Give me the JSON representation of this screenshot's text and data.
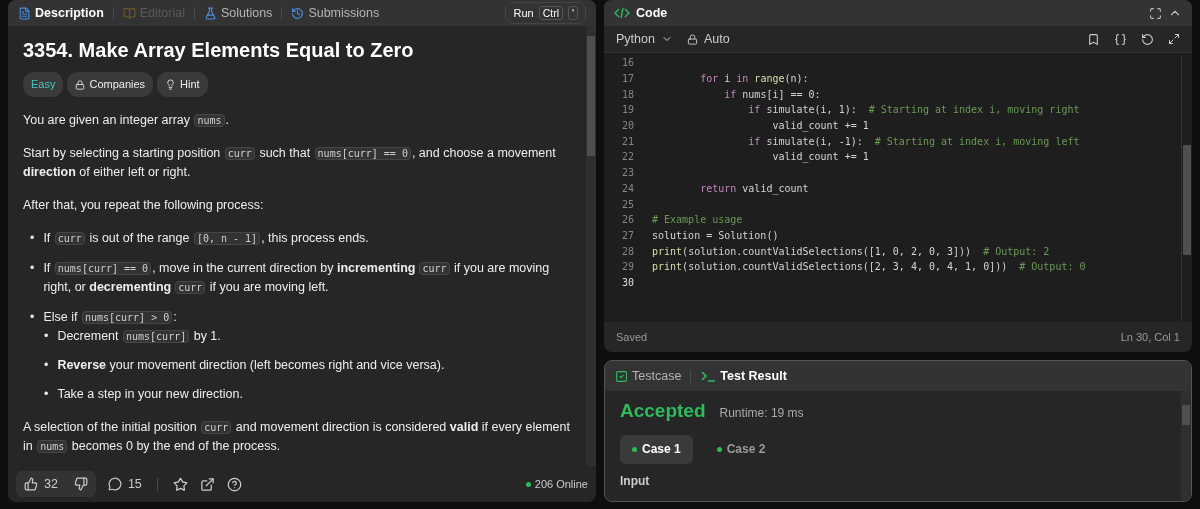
{
  "description_panel": {
    "tabs": [
      {
        "label": "Description",
        "kind": "doc",
        "selected": true,
        "disabled": false
      },
      {
        "label": "Editorial",
        "kind": "book",
        "selected": false,
        "disabled": true
      },
      {
        "label": "Solutions",
        "kind": "flask",
        "selected": false,
        "disabled": false
      },
      {
        "label": "Submissions",
        "kind": "history",
        "selected": false,
        "disabled": false
      }
    ],
    "run_button": {
      "label": "Run",
      "keys": [
        "Ctrl",
        "'"
      ]
    },
    "title": "3354. Make Array Elements Equal to Zero",
    "tags": [
      {
        "label": "Easy",
        "kind": "difficulty"
      },
      {
        "label": "Companies",
        "kind": "lock"
      },
      {
        "label": "Hint",
        "kind": "bulb"
      }
    ],
    "blocks": [
      {
        "kind": "p",
        "parts": [
          {
            "kind": "text",
            "text": "You are given an integer array "
          },
          {
            "kind": "code",
            "text": "nums"
          },
          {
            "kind": "text",
            "text": "."
          }
        ]
      },
      {
        "kind": "p",
        "parts": [
          {
            "kind": "text",
            "text": "Start by selecting a starting position "
          },
          {
            "kind": "code",
            "text": "curr"
          },
          {
            "kind": "text",
            "text": " such that "
          },
          {
            "kind": "code",
            "text": "nums[curr] == 0"
          },
          {
            "kind": "text",
            "text": ", and choose a movement "
          },
          {
            "kind": "bold",
            "text": "direction"
          },
          {
            "kind": "text",
            "text": " of either left or right."
          }
        ]
      },
      {
        "kind": "p",
        "parts": [
          {
            "kind": "text",
            "text": "After that, you repeat the following process:"
          }
        ]
      },
      {
        "kind": "list",
        "items": [
          {
            "marker": "•",
            "parts": [
              {
                "kind": "text",
                "text": "If "
              },
              {
                "kind": "code",
                "text": "curr"
              },
              {
                "kind": "text",
                "text": " is out of the range "
              },
              {
                "kind": "code",
                "text": "[0, n - 1]"
              },
              {
                "kind": "text",
                "text": ", this process ends."
              }
            ]
          },
          {
            "marker": "•",
            "parts": [
              {
                "kind": "text",
                "text": "If "
              },
              {
                "kind": "code",
                "text": "nums[curr] == 0"
              },
              {
                "kind": "text",
                "text": ", move in the current direction by "
              },
              {
                "kind": "bold",
                "text": "incrementing"
              },
              {
                "kind": "code",
                "text": "curr"
              },
              {
                "kind": "text",
                "text": " if you are moving right, or "
              },
              {
                "kind": "bold",
                "text": "decrementing"
              },
              {
                "kind": "code",
                "text": "curr"
              },
              {
                "kind": "text",
                "text": " if you are moving left."
              }
            ]
          },
          {
            "marker": "•",
            "parts": [
              {
                "kind": "text",
                "text": "Else if "
              },
              {
                "kind": "code",
                "text": "nums[curr] > 0"
              },
              {
                "kind": "text",
                "text": ":"
              }
            ],
            "children": [
              {
                "marker": "•",
                "parts": [
                  {
                    "kind": "text",
                    "text": "Decrement "
                  },
                  {
                    "kind": "code",
                    "text": "nums[curr]"
                  },
                  {
                    "kind": "text",
                    "text": " by 1."
                  }
                ]
              },
              {
                "marker": "•",
                "parts": [
                  {
                    "kind": "bold",
                    "text": "Reverse"
                  },
                  {
                    "kind": "text",
                    "text": " your movement direction (left becomes right and vice versa)."
                  }
                ]
              },
              {
                "marker": "•",
                "parts": [
                  {
                    "kind": "text",
                    "text": "Take a step in your new direction."
                  }
                ]
              }
            ]
          }
        ]
      },
      {
        "kind": "p",
        "parts": [
          {
            "kind": "text",
            "text": "A selection of the initial position "
          },
          {
            "kind": "code",
            "text": "curr"
          },
          {
            "kind": "text",
            "text": " and movement direction is considered "
          },
          {
            "kind": "bold",
            "text": "valid"
          },
          {
            "kind": "text",
            "text": " if every element in "
          },
          {
            "kind": "code",
            "text": "nums"
          },
          {
            "kind": "text",
            "text": " becomes 0 by the end of the process."
          }
        ]
      }
    ],
    "footer": {
      "likes": "32",
      "comments": "15",
      "online": "206 Online"
    }
  },
  "code_panel": {
    "title": "Code",
    "language": "Python",
    "mode": "Auto",
    "lines": [
      {
        "number": "16",
        "current": false
      },
      {
        "number": "17",
        "current": false,
        "tokens": [
          {
            "kind": "keyword",
            "text": "        for"
          },
          {
            "kind": "plain",
            "text": " i "
          },
          {
            "kind": "keyword",
            "text": "in"
          },
          {
            "kind": "func",
            "text": " range"
          },
          {
            "kind": "plain",
            "text": "(n):"
          }
        ]
      },
      {
        "number": "18",
        "current": false,
        "tokens": [
          {
            "kind": "keyword",
            "text": "            if"
          },
          {
            "kind": "plain",
            "text": " nums[i] == 0:"
          }
        ]
      },
      {
        "number": "19",
        "current": false,
        "tokens": [
          {
            "kind": "keyword",
            "text": "                if"
          },
          {
            "kind": "plain",
            "text": " simulate(i, 1):  "
          },
          {
            "kind": "comment",
            "text": "# Starting at index i, moving right"
          }
        ]
      },
      {
        "number": "20",
        "current": false,
        "tokens": [
          {
            "kind": "plain",
            "text": "                    valid_count += 1"
          }
        ]
      },
      {
        "number": "21",
        "current": false,
        "tokens": [
          {
            "kind": "keyword",
            "text": "                if"
          },
          {
            "kind": "plain",
            "text": " simulate(i, -1):  "
          },
          {
            "kind": "comment",
            "text": "# Starting at index i, moving left"
          }
        ]
      },
      {
        "number": "22",
        "current": false,
        "tokens": [
          {
            "kind": "plain",
            "text": "                    valid_count += 1"
          }
        ]
      },
      {
        "number": "23",
        "current": false
      },
      {
        "number": "24",
        "current": false,
        "tokens": [
          {
            "kind": "keyword",
            "text": "        return"
          },
          {
            "kind": "plain",
            "text": " valid_count"
          }
        ]
      },
      {
        "number": "25",
        "current": false
      },
      {
        "number": "26",
        "current": false,
        "tokens": [
          {
            "kind": "comment",
            "text": "# Example usage"
          }
        ]
      },
      {
        "number": "27",
        "current": false,
        "tokens": [
          {
            "kind": "plain",
            "text": "solution = Solution()"
          }
        ]
      },
      {
        "number": "28",
        "current": false,
        "tokens": [
          {
            "kind": "func",
            "text": "print"
          },
          {
            "kind": "plain",
            "text": "(solution.countValidSelections([1, 0, 2, 0, 3]))  "
          },
          {
            "kind": "comment",
            "text": "# Output: 2"
          }
        ]
      },
      {
        "number": "29",
        "current": false,
        "tokens": [
          {
            "kind": "func",
            "text": "print"
          },
          {
            "kind": "plain",
            "text": "(solution.countValidSelections([2, 3, 4, 0, 4, 1, 0]))  "
          },
          {
            "kind": "comment",
            "text": "# Output: 0"
          }
        ]
      },
      {
        "number": "30",
        "current": true
      }
    ],
    "status": "Saved",
    "cursor": "Ln 30, Col 1"
  },
  "test_panel": {
    "tabs": [
      {
        "label": "Testcase",
        "kind": "check",
        "selected": false
      },
      {
        "label": "Test Result",
        "kind": "terminal",
        "selected": true
      }
    ],
    "verdict": "Accepted",
    "runtime": "Runtime: 19 ms",
    "cases": [
      {
        "label": "Case 1",
        "selected": true
      },
      {
        "label": "Case 2",
        "selected": false
      }
    ],
    "input_label": "Input"
  }
}
